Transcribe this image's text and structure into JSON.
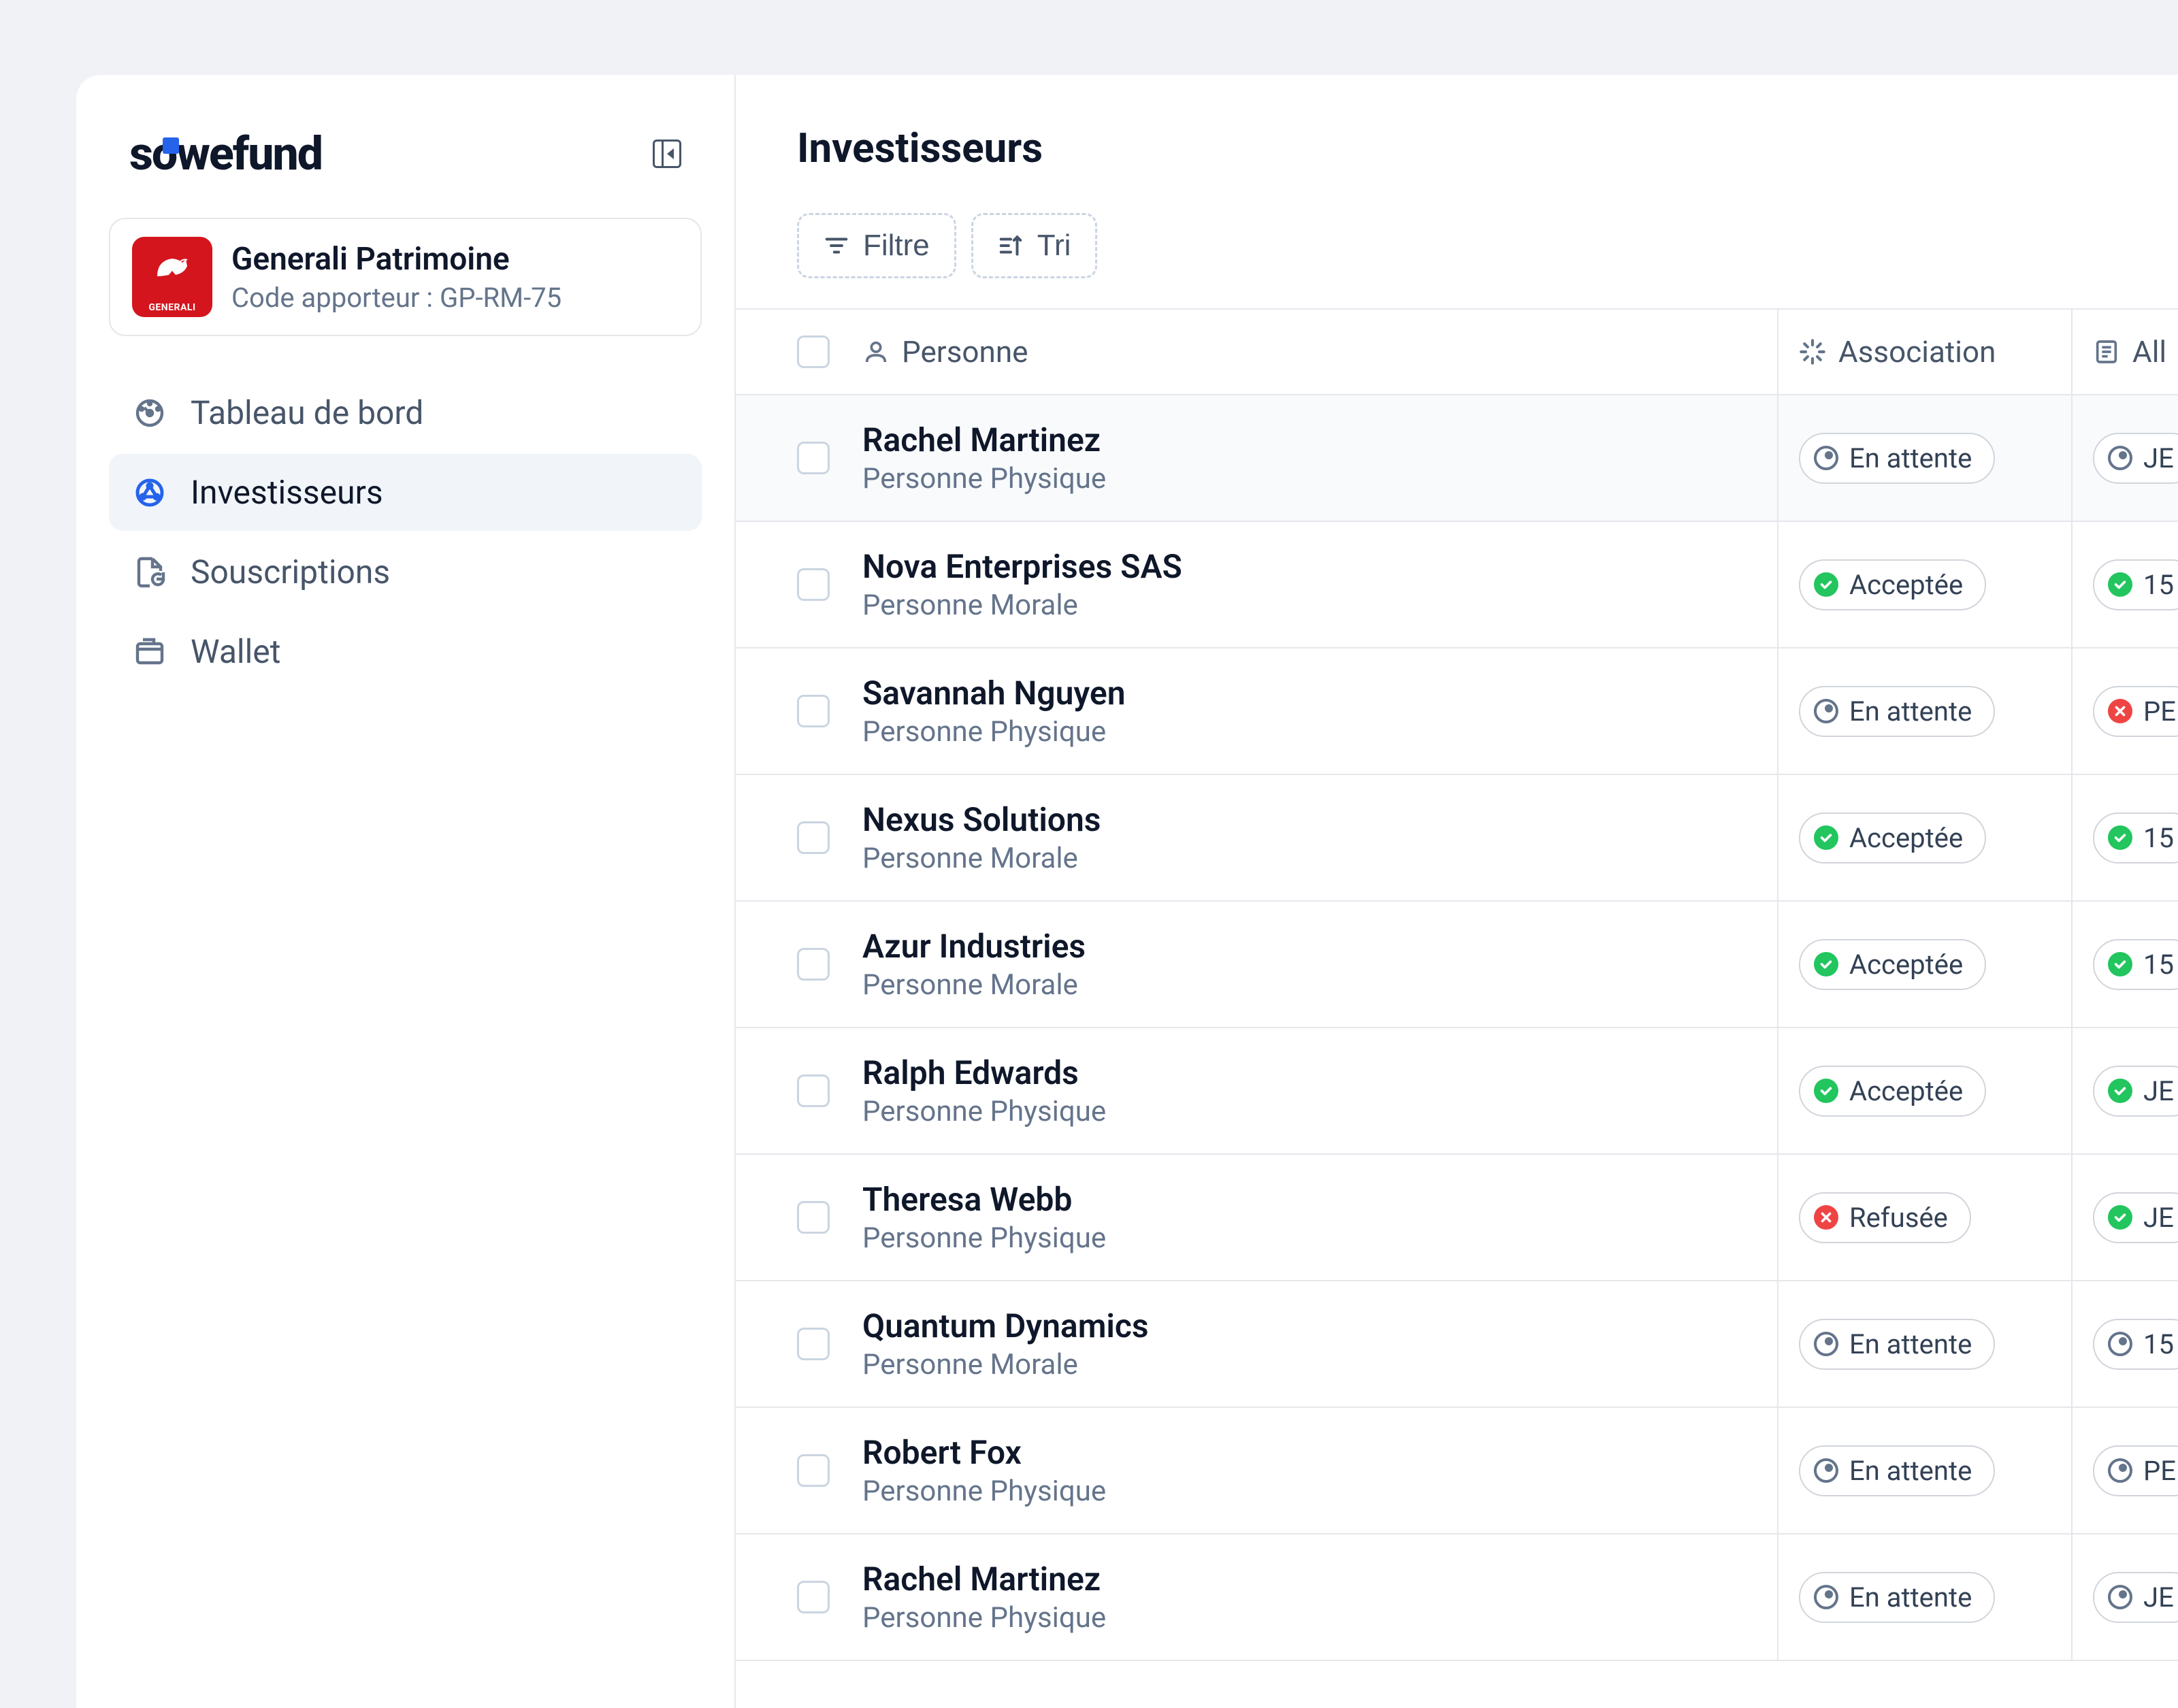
{
  "logo": "sowefund",
  "org": {
    "name": "Generali Patrimoine",
    "code": "Code apporteur : GP-RM-75",
    "badge": "GENERALI"
  },
  "sidebar": {
    "items": [
      {
        "label": "Tableau de bord",
        "icon": "gauge"
      },
      {
        "label": "Investisseurs",
        "icon": "network",
        "active": true
      },
      {
        "label": "Souscriptions",
        "icon": "file-refresh"
      },
      {
        "label": "Wallet",
        "icon": "wallet"
      }
    ]
  },
  "page": {
    "title": "Investisseurs"
  },
  "toolbar": {
    "filter_label": "Filtre",
    "sort_label": "Tri"
  },
  "table": {
    "headers": {
      "person": "Personne",
      "association": "Association",
      "allocation": "All"
    },
    "status_labels": {
      "pending": "En attente",
      "accepted": "Acceptée",
      "refused": "Refusée"
    },
    "rows": [
      {
        "name": "Rachel Martinez",
        "type": "Personne Physique",
        "association": "pending",
        "alloc_status": "pending",
        "alloc_text": "JE",
        "active": true
      },
      {
        "name": "Nova Enterprises SAS",
        "type": "Personne Morale",
        "association": "accepted",
        "alloc_status": "accepted",
        "alloc_text": "15"
      },
      {
        "name": "Savannah Nguyen",
        "type": "Personne Physique",
        "association": "pending",
        "alloc_status": "refused",
        "alloc_text": "PE"
      },
      {
        "name": "Nexus Solutions",
        "type": "Personne Morale",
        "association": "accepted",
        "alloc_status": "accepted",
        "alloc_text": "15"
      },
      {
        "name": "Azur Industries",
        "type": "Personne Morale",
        "association": "accepted",
        "alloc_status": "accepted",
        "alloc_text": "15"
      },
      {
        "name": "Ralph Edwards",
        "type": "Personne Physique",
        "association": "accepted",
        "alloc_status": "accepted",
        "alloc_text": "JE"
      },
      {
        "name": "Theresa Webb",
        "type": "Personne Physique",
        "association": "refused",
        "alloc_status": "accepted",
        "alloc_text": "JE"
      },
      {
        "name": "Quantum Dynamics",
        "type": "Personne Morale",
        "association": "pending",
        "alloc_status": "pending",
        "alloc_text": "15"
      },
      {
        "name": "Robert Fox",
        "type": "Personne Physique",
        "association": "pending",
        "alloc_status": "pending",
        "alloc_text": "PE"
      },
      {
        "name": "Rachel Martinez",
        "type": "Personne Physique",
        "association": "pending",
        "alloc_status": "pending",
        "alloc_text": "JE"
      }
    ]
  }
}
